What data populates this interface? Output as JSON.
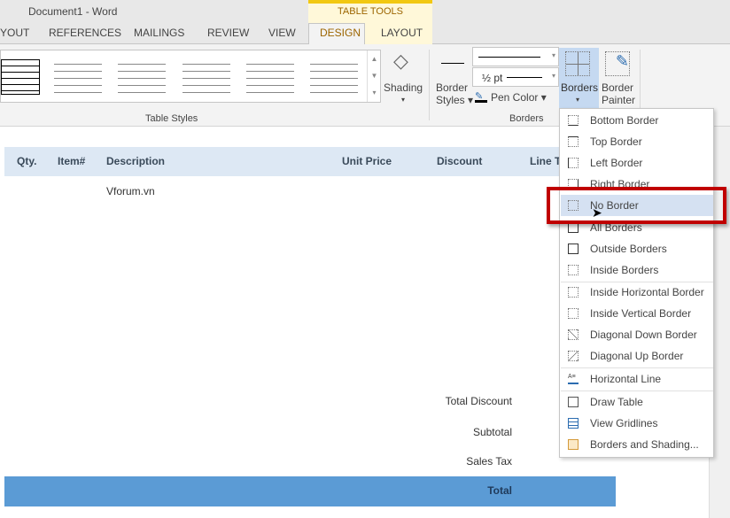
{
  "window": {
    "title": "Document1 - Word"
  },
  "tabs": [
    "YOUT",
    "REFERENCES",
    "MAILINGS",
    "REVIEW",
    "VIEW"
  ],
  "table_tools": {
    "label": "TABLE TOOLS",
    "tabs": [
      "DESIGN",
      "LAYOUT"
    ],
    "active": "DESIGN"
  },
  "ribbon": {
    "shading_label": "Shading",
    "table_styles_group": "Table Styles",
    "border_styles_label": [
      "Border",
      "Styles"
    ],
    "pen_weight": "½ pt",
    "pen_color_label": "Pen Color",
    "borders_label": "Borders",
    "border_painter_label": [
      "Border",
      "Painter"
    ],
    "borders_group": "Borders"
  },
  "table": {
    "headers": [
      "Qty.",
      "Item#",
      "Description",
      "Unit Price",
      "Discount",
      "Line T"
    ],
    "row1_description": "Vforum.vn",
    "summary": [
      "Total Discount",
      "Subtotal",
      "Sales Tax"
    ],
    "total_label": "Total",
    "header_color": "#dde8f4",
    "total_color": "#5b9bd5"
  },
  "borders_menu": {
    "items": [
      "Bottom Border",
      "Top Border",
      "Left Border",
      "Right Border",
      "No Border",
      "All Borders",
      "Outside Borders",
      "Inside Borders",
      "Inside Horizontal Border",
      "Inside Vertical Border",
      "Diagonal Down Border",
      "Diagonal Up Border",
      "Horizontal Line",
      "Draw Table",
      "View Gridlines",
      "Borders and Shading..."
    ],
    "highlighted": "No Border",
    "highlight_box_color": "#c00000"
  }
}
